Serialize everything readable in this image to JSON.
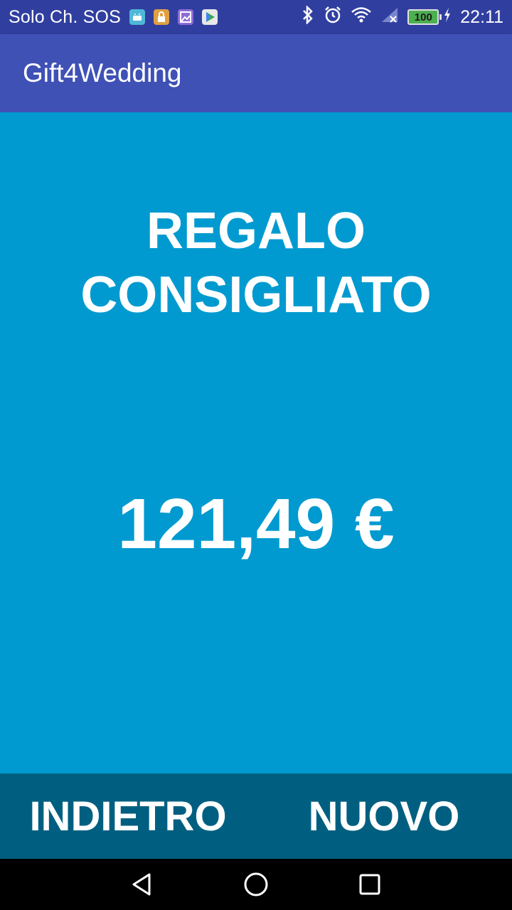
{
  "status_bar": {
    "carrier": "Solo Ch. SOS",
    "battery": "100",
    "time": "22:11",
    "notification_icons": [
      "android-icon",
      "lock-icon",
      "gallery-icon",
      "play-store-icon"
    ],
    "system_icons": [
      "bluetooth-icon",
      "alarm-icon",
      "wifi-icon",
      "signal-icon",
      "battery-icon",
      "charging-icon"
    ]
  },
  "app_bar": {
    "title": "Gift4Wedding",
    "color": "#3f51b5"
  },
  "main": {
    "heading_line1": "REGALO",
    "heading_line2": "CONSIGLIATO",
    "amount": "121,49 €",
    "background": "#009ad0"
  },
  "bottom_bar": {
    "back_label": "INDIETRO",
    "new_label": "NUOVO",
    "background": "#005f80"
  },
  "nav_bar": {
    "buttons": [
      "back-icon",
      "home-icon",
      "recents-icon"
    ]
  }
}
